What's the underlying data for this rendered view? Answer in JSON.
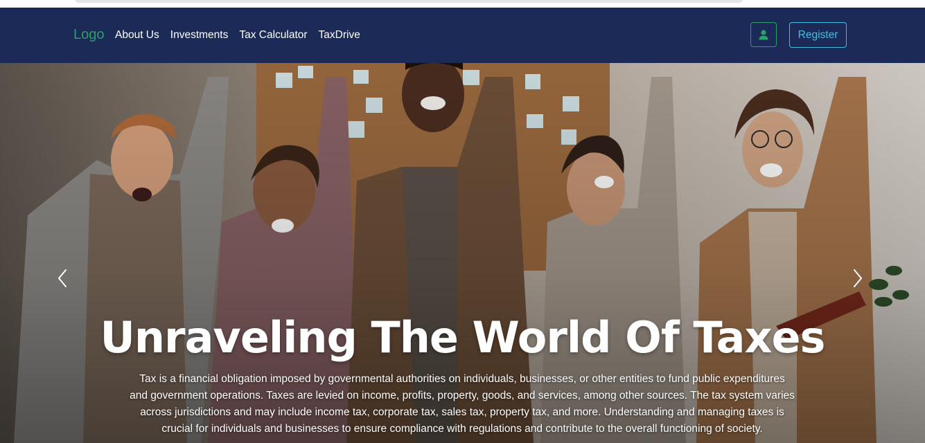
{
  "nav": {
    "logo": "Logo",
    "links": [
      {
        "label": "About Us"
      },
      {
        "label": "Investments"
      },
      {
        "label": "Tax Calculator"
      },
      {
        "label": "TaxDrive"
      }
    ],
    "user_icon": "user-icon",
    "register_label": "Register"
  },
  "hero": {
    "title": "Unraveling The World Of Taxes",
    "description": "Tax is a financial obligation imposed by governmental authorities on individuals, businesses, or other entities to fund public expenditures and government operations. Taxes are levied on income, profits, property, goods, and services, among other sources. The tax system varies across jurisdictions and may include income tax, corporate tax, sales tax, property tax, and more. Understanding and managing taxes is crucial for individuals and businesses to ensure compliance with regulations and contribute to the overall functioning of society.",
    "prev_icon": "chevron-left-icon",
    "next_icon": "chevron-right-icon"
  },
  "colors": {
    "navbar_bg": "#1c2a57",
    "logo": "#2c9f6b",
    "register_accent": "#3fc1e6",
    "user_button_accent": "#2c9f6b"
  }
}
